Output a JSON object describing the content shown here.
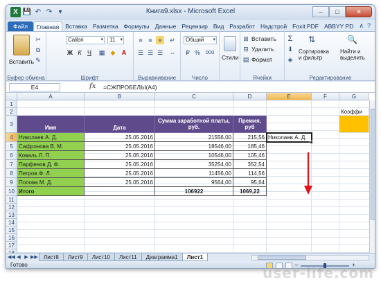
{
  "window": {
    "title": "Книга9.xlsx - Microsoft Excel",
    "logo_letter": "X",
    "controls": {
      "minimize": "–",
      "maximize": "□",
      "close": "✕"
    }
  },
  "qat": {
    "save_icon": "💾",
    "undo_icon": "↶",
    "redo_icon": "↷",
    "customize_icon": "▾"
  },
  "tabs": [
    {
      "label": "Файл"
    },
    {
      "label": "Главная"
    },
    {
      "label": "Вставка"
    },
    {
      "label": "Разметка"
    },
    {
      "label": "Формулы"
    },
    {
      "label": "Данные"
    },
    {
      "label": "Рецензир"
    },
    {
      "label": "Вид"
    },
    {
      "label": "Разработ"
    },
    {
      "label": "Надстрой"
    },
    {
      "label": "Foxit PDF"
    },
    {
      "label": "ABBYY PD"
    }
  ],
  "ribbon": {
    "clipboard": {
      "label": "Буфер обмена",
      "paste": "Вставить"
    },
    "font": {
      "label": "Шрифт",
      "name": "Calibri",
      "size": "11",
      "bold": "Ж",
      "italic": "К",
      "underline": "Ч"
    },
    "alignment": {
      "label": "Выравнивание"
    },
    "number": {
      "label": "Число",
      "format": "Общий",
      "percent": "%",
      "thousands": "000"
    },
    "styles": {
      "label": "Стили"
    },
    "cells": {
      "label": "Ячейки",
      "insert": "Вставить",
      "delete": "Удалить",
      "format": "Формат"
    },
    "editing": {
      "label": "Редактирование",
      "sigma": "Σ",
      "sort": "Сортировка\nи фильтр",
      "sort_l1": "Сортировка",
      "sort_l2": "и фильтр",
      "find_l1": "Найти и",
      "find_l2": "выделить"
    }
  },
  "formula_bar": {
    "name_box": "E4",
    "fx": "fx",
    "formula": "=СЖПРОБЕЛЫ(A4)"
  },
  "columns": [
    "A",
    "B",
    "C",
    "D",
    "E",
    "F",
    "G"
  ],
  "rows": [
    "1",
    "2",
    "3",
    "4",
    "5",
    "6",
    "7",
    "8",
    "9",
    "10",
    "11",
    "12",
    "13",
    "14",
    "15",
    "16",
    "17",
    "18"
  ],
  "table": {
    "headers": [
      "Имя",
      "Дата",
      "Сумма заработной платы, руб.",
      "Премия, руб"
    ],
    "data": [
      [
        "Николаев А. Д.",
        "25.05.2016",
        "21556,00",
        "215,56"
      ],
      [
        "Сафронова В. М.",
        "25.05.2016",
        "18546,00",
        "185,46"
      ],
      [
        "Коваль Л. П.",
        "25.05.2016",
        "10546,00",
        "105,46"
      ],
      [
        "Парфенов Д. Ф.",
        "25.05.2016",
        "35254,00",
        "352,54"
      ],
      [
        "Петров Ф. Л.",
        "25.05.2016",
        "11456,00",
        "114,56"
      ],
      [
        "Попова М. Д.",
        "25.05.2016",
        "9564,00",
        "95,64"
      ]
    ],
    "total": [
      "Итого",
      "",
      "106922",
      "1069,22"
    ]
  },
  "cell_e4": "Николаев А. Д.",
  "cell_g2": "Коэффи",
  "sheet_tabs": [
    "Лист8",
    "Лист9",
    "Лист10",
    "Лист11",
    "Диаграмма1",
    "Лист1"
  ],
  "sheet_nav": {
    "first": "◀◀",
    "prev": "◀",
    "next": "▶",
    "last": "▶▶"
  },
  "status": {
    "ready": "Готово"
  },
  "watermark": "user-life.com"
}
